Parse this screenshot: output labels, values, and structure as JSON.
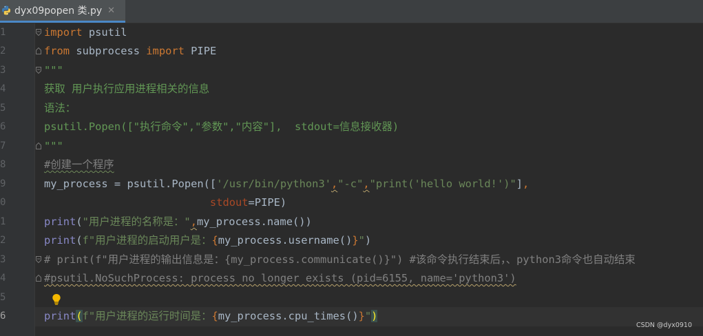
{
  "tab": {
    "filename": "dyx09popen 类.py",
    "close_symbol": "✕",
    "icon": "python-file-icon"
  },
  "gutter": {
    "line_numbers": [
      "1",
      "2",
      "3",
      "4",
      "5",
      "6",
      "7",
      "8",
      "9",
      "0",
      "1",
      "2",
      "3",
      "4",
      "5",
      "6"
    ],
    "current_line": "6"
  },
  "code": {
    "l1": {
      "kw": "import",
      "rest": " psutil"
    },
    "l2": {
      "kw1": "from",
      "mid": " subprocess ",
      "kw2": "import",
      "rest": " PIPE"
    },
    "l3": {
      "doc": "\"\"\""
    },
    "l4": {
      "doc": "获取 用户执行应用进程相关的信息"
    },
    "l5": {
      "doc": "语法："
    },
    "l6": {
      "doc": "psutil.Popen([\"执行命令\",\"参数\",\"内容\"],  stdout=信息接收器)"
    },
    "l7": {
      "doc": "\"\"\""
    },
    "l8": {
      "cmt": "#创建一个程序"
    },
    "l9": {
      "a": "my_process = psutil.Popen([",
      "s1": "'/usr/bin/python3'",
      "c1": ",",
      "s2": "\"-c\"",
      "c2": ",",
      "s3": "\"print('hello world!')\"",
      "b": "]",
      "c3": ","
    },
    "l10": {
      "indent": "                          ",
      "kwarg": "stdout",
      "rest": "=PIPE)"
    },
    "l11": {
      "fn": "print",
      "p1": "(",
      "s": "\"用户进程的名称是：\"",
      "c": ",",
      "rest": "my_process.name())"
    },
    "l12": {
      "fn": "print",
      "p1": "(",
      "s1": "f\"用户进程的启动用户是：",
      "b1": "{",
      "mid": "my_process.username()",
      "b2": "}",
      "s2": "\"",
      "p2": ")"
    },
    "l13": {
      "cmt": "# print(f\"用户进程的输出信息是：{my_process.communicate()}\") #该命令执行结束后，、python3命令也自动结束"
    },
    "l14": {
      "cmt": "#psutil.NoSuchProcess: process no longer exists (pid=6155, name='python3')"
    },
    "l16": {
      "fn": "print",
      "p1": "(",
      "s1": "f\"用户进程的运行时间是：",
      "b1": "{",
      "mid": "my_process.cpu_times()",
      "b2": "}",
      "s2": "\"",
      "p2": ")"
    }
  },
  "watermark": "CSDN @dyx0910",
  "colors": {
    "background": "#2b2b2b",
    "keyword": "#cc7832",
    "string": "#6a8759",
    "docstring": "#629755",
    "comment": "#808080",
    "builtin": "#8888c6",
    "kwarg": "#aa4926"
  }
}
